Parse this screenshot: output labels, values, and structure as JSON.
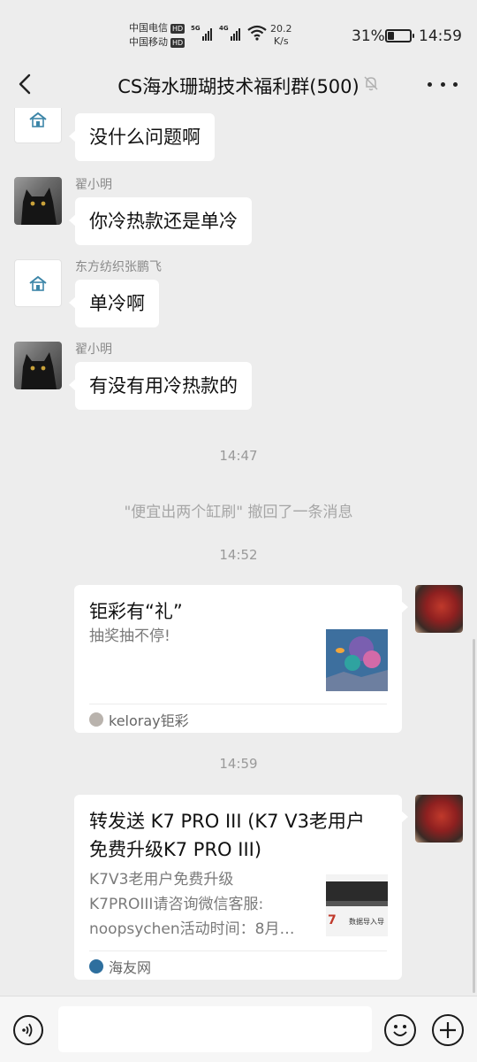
{
  "status_bar": {
    "carrier_1": "中国电信",
    "carrier_2": "中国移动",
    "hd_label": "HD",
    "signal_1_tag": "5G",
    "signal_2_tag": "4G",
    "net_speed_value": "20.2",
    "net_speed_unit": "K/s",
    "battery_percent": "31%",
    "battery_level": 0.31,
    "time": "14:59"
  },
  "header": {
    "title": "CS海水珊瑚技术福利群(500)",
    "back_icon": "chevron-left-icon",
    "mute_icon": "bell-off-icon",
    "more_icon": "more-dots-icon"
  },
  "messages": [
    {
      "sender": "",
      "text": "没什么问题啊",
      "avatar": "house-logo"
    },
    {
      "sender": "翟小明",
      "text": "你冷热款还是单冷",
      "avatar": "black-cat"
    },
    {
      "sender": "东方纺织张鹏飞",
      "text": "单冷啊",
      "avatar": "house-logo"
    },
    {
      "sender": "翟小明",
      "text": "有没有用冷热款的",
      "avatar": "black-cat"
    }
  ],
  "timestamps": [
    "14:47",
    "14:52",
    "14:59"
  ],
  "recall_notice": "\"便宜出两个缸刷\" 撤回了一条消息",
  "cards": [
    {
      "title": "钜彩有“礼”",
      "description": "抽奖抽不停!",
      "source": "keloray钜彩",
      "thumb_color": "#3d6f9e"
    },
    {
      "title": "转发送 K7 PRO III (K7 V3老用户免费升级K7 PRO III)",
      "description_lines": [
        "K7V3老用户免费升级",
        "K7PROIII请咨询微信客服:",
        "noopsychen活动时间：8月…"
      ],
      "source": "海友网",
      "thumb_text_1": "7",
      "thumb_text_2": "数据导入导"
    }
  ],
  "input_bar": {
    "voice_icon": "voice-icon",
    "emoji_icon": "emoji-icon",
    "plus_icon": "plus-icon",
    "input_value": ""
  },
  "colors": {
    "background": "#ededed",
    "bubble": "#ffffff",
    "meta_text": "#9a9a9a"
  }
}
